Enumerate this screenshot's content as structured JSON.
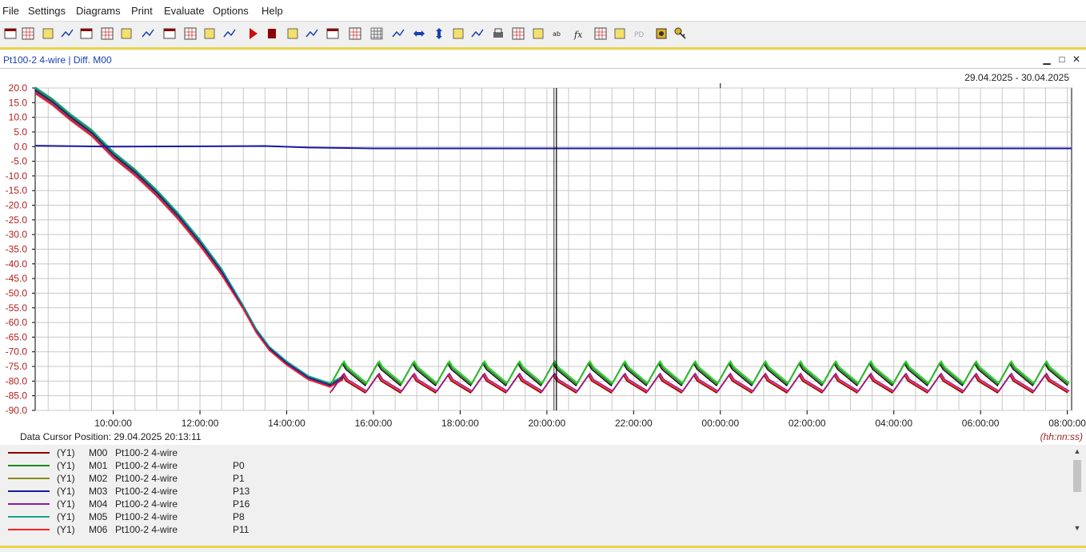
{
  "menu": [
    "File",
    "Settings",
    "Diagrams",
    "Print",
    "Evaluate",
    "Options",
    "Help"
  ],
  "toolbar_icons": [
    "new-diagram-icon",
    "open-diagram-icon",
    "add-diagram-icon",
    "remove-diagram-icon",
    "bar-diagram-icon",
    "table-icon",
    "table-grid-icon",
    "copy-icon",
    "note-icon",
    "layout-grid-icon",
    "layout-stack-icon",
    "arrow-right-icon",
    "play-icon",
    "stop-icon",
    "channel-select-icon",
    "curve-icon",
    "marker-icon",
    "cursor-icon",
    "grid-icon",
    "zoom-box-icon",
    "zoom-horizontal-icon",
    "zoom-vertical-icon",
    "undo-zoom-icon",
    "zoom-disabled-icon",
    "print-icon",
    "print-preview-icon",
    "copy-window-icon",
    "text-label-icon",
    "formula-icon",
    "filter-icon",
    "curve-disabled-icon",
    "pd-icon",
    "settings-icon",
    "key-icon"
  ],
  "window": {
    "title": "Pt100-2 4-wire | Diff. M00",
    "minimize": "▁",
    "maximize": "□",
    "close": "✕"
  },
  "chart_header": {
    "date_range": "29.04.2025 - 30.04.2025"
  },
  "cursor": {
    "label": "Data Cursor Position: 29.04.2025 20:13:11",
    "time_format": "(hh:nn:ss)"
  },
  "legend": [
    {
      "axis": "(Y1)",
      "channel": "M00",
      "name": "Pt100-2 4-wire",
      "pos": "",
      "color": "#8b0000"
    },
    {
      "axis": "(Y1)",
      "channel": "M01",
      "name": "Pt100-2 4-wire",
      "pos": "P0",
      "color": "#1a8a1a"
    },
    {
      "axis": "(Y1)",
      "channel": "M02",
      "name": "Pt100-2 4-wire",
      "pos": "P1",
      "color": "#8b8b1a"
    },
    {
      "axis": "(Y1)",
      "channel": "M03",
      "name": "Pt100-2 4-wire",
      "pos": "P13",
      "color": "#1a1aa0"
    },
    {
      "axis": "(Y1)",
      "channel": "M04",
      "name": "Pt100-2 4-wire",
      "pos": "P16",
      "color": "#8a1aa0"
    },
    {
      "axis": "(Y1)",
      "channel": "M05",
      "name": "Pt100-2 4-wire",
      "pos": "P8",
      "color": "#1aa08a"
    },
    {
      "axis": "(Y1)",
      "channel": "M06",
      "name": "Pt100-2 4-wire",
      "pos": "P11",
      "color": "#ff2020"
    }
  ],
  "chart_data": {
    "type": "line",
    "title": "",
    "xlabel": "",
    "ylabel": "",
    "x_ticks": [
      "10:00:00",
      "12:00:00",
      "14:00:00",
      "16:00:00",
      "18:00:00",
      "20:00:00",
      "22:00:00",
      "00:00:00",
      "02:00:00",
      "04:00:00",
      "06:00:00",
      "08:00:00"
    ],
    "x_range_hours": [
      8.2,
      32.1
    ],
    "ylim": [
      -90,
      20
    ],
    "y_tick_step": 5,
    "grid": true,
    "cursor_time_hours": 20.22,
    "main_curve": {
      "name": "M00",
      "points": [
        [
          8.2,
          19
        ],
        [
          8.6,
          15
        ],
        [
          9.0,
          10
        ],
        [
          9.5,
          4.5
        ],
        [
          10.0,
          -3
        ],
        [
          10.5,
          -9
        ],
        [
          11.0,
          -16
        ],
        [
          11.5,
          -24
        ],
        [
          12.0,
          -33
        ],
        [
          12.5,
          -43
        ],
        [
          13.0,
          -55
        ],
        [
          13.3,
          -63
        ],
        [
          13.6,
          -69
        ],
        [
          14.0,
          -74
        ],
        [
          14.5,
          -79
        ],
        [
          15.0,
          -81.5
        ],
        [
          15.3,
          -79
        ]
      ],
      "colors": [
        "#8b0000",
        "#1a8a1a",
        "#8b8b1a",
        "#1a1aa0",
        "#8a1aa0",
        "#1aa08a",
        "#ff2020"
      ]
    },
    "cycle": {
      "start_hours": 15.0,
      "period_hours": 0.81,
      "upper_series": {
        "colors": [
          "#1a1a1a",
          "#1a8a1a",
          "#28d028"
        ],
        "min": -81.5,
        "max": -74
      },
      "lower_series": {
        "colors": [
          "#8b0000",
          "#ff2020",
          "#8a1aa0"
        ],
        "min": -84,
        "max": -78
      }
    },
    "diff_series": {
      "name": "Diff. M00",
      "color": "#1a1aa0",
      "points": [
        [
          8.2,
          0.3
        ],
        [
          10.0,
          0.0
        ],
        [
          12.0,
          0.1
        ],
        [
          13.5,
          0.2
        ],
        [
          14.5,
          -0.3
        ],
        [
          16.0,
          -0.6
        ],
        [
          32.1,
          -0.6
        ]
      ]
    }
  }
}
